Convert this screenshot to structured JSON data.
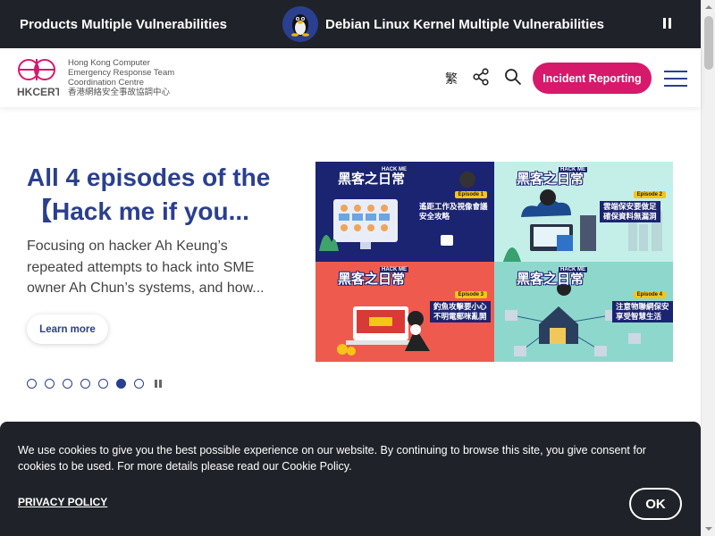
{
  "ticker": {
    "item1": "Products Multiple Vulnerabilities",
    "item2": "Debian Linux Kernel Multiple Vulnerabilities",
    "pause_icon": "pause-icon",
    "item2_icon": "linux-tux-icon"
  },
  "header": {
    "logo_text": "HKCERT",
    "logo_lines": [
      "Hong Kong Computer",
      "Emergency Response Team",
      "Coordination Centre",
      "香港網絡安全事故協調中心"
    ],
    "lang_label": "繁",
    "share_icon": "share-icon",
    "search_icon": "search-icon",
    "incident_label": "Incident Reporting",
    "menu_icon": "hamburger-menu-icon"
  },
  "hero": {
    "title": "All 4 episodes of the 【Hack me if you...",
    "description": "Focusing on hacker Ah Keung’s repeated attempts to hack into SME owner Ah Chun’s systems, and how...",
    "learn_more": "Learn more",
    "slide_count": 7,
    "active_slide": 6,
    "slider_pause_icon": "pause-icon"
  },
  "collage": {
    "brand": "黑客之日常",
    "brand_sub": "HACK ME",
    "tiles": [
      {
        "episode": "Episode 1",
        "caption": [
          "遙距工作及視像會議",
          "安全攻略"
        ]
      },
      {
        "episode": "Episode 2",
        "caption": [
          "雲端保安要做足",
          "確保資料無漏洞"
        ]
      },
      {
        "episode": "Episode 3",
        "caption": [
          "釣魚攻擊要小心",
          "不明電郵咪亂開"
        ]
      },
      {
        "episode": "Episode 4",
        "caption": [
          "注意物聯網保安",
          "享受智慧生活"
        ]
      }
    ]
  },
  "cookie": {
    "text": "We use cookies to give you the best possible experience on our website. By continuing to browse this site, you give consent for cookies to be used. For more details please read our Cookie Policy.",
    "privacy_label": "PRIVACY POLICY",
    "ok_label": "OK"
  },
  "colors": {
    "brand_blue": "#2a3f8f",
    "incident_pink": "#d6196b",
    "dark_bar": "#1f2329"
  }
}
